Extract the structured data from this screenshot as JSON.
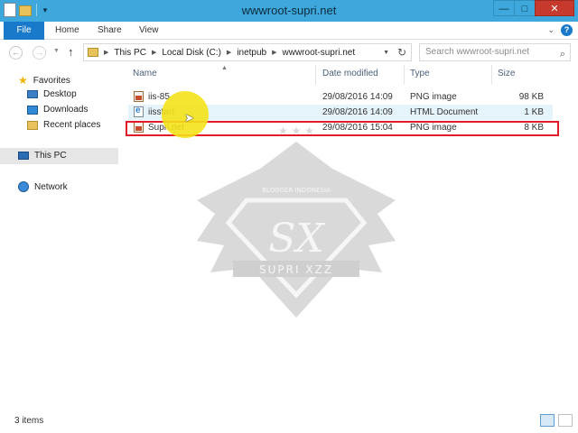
{
  "window": {
    "title": "wwwroot-supri.net"
  },
  "controls": {
    "minimize": "—",
    "maximize": "□",
    "close": "✕"
  },
  "ribbon": {
    "file": "File",
    "home": "Home",
    "share": "Share",
    "view": "View"
  },
  "address": {
    "crumbs": [
      "This PC",
      "Local Disk (C:)",
      "inetpub",
      "wwwroot-supri.net"
    ],
    "search_placeholder": "Search wwwroot-supri.net"
  },
  "nav": {
    "favorites": "Favorites",
    "desktop": "Desktop",
    "downloads": "Downloads",
    "recent": "Recent places",
    "this_pc": "This PC",
    "network": "Network"
  },
  "columns": {
    "name": "Name",
    "date": "Date modified",
    "type": "Type",
    "size": "Size"
  },
  "files": [
    {
      "name": "iis-85",
      "date": "29/08/2016 14:09",
      "type": "PNG image",
      "size": "98 KB",
      "icon": "png-file-icon"
    },
    {
      "name": "iisstart",
      "date": "29/08/2016 14:09",
      "type": "HTML Document",
      "size": "1 KB",
      "icon": "html-file-icon"
    },
    {
      "name": "Supri.net",
      "date": "29/08/2016 15:04",
      "type": "PNG image",
      "size": "8 KB",
      "icon": "png-file-icon"
    }
  ],
  "watermark": {
    "top": "BLOGGER INDONESIA",
    "center": "SX",
    "bottom": "SUPRI XZZ"
  },
  "status": {
    "items": "3 items"
  },
  "colors": {
    "titlebar": "#3ea8dc",
    "file_tab": "#1979ca",
    "close": "#c7392c",
    "highlight": "#e21b2b",
    "cursor": "#f4e21a"
  }
}
